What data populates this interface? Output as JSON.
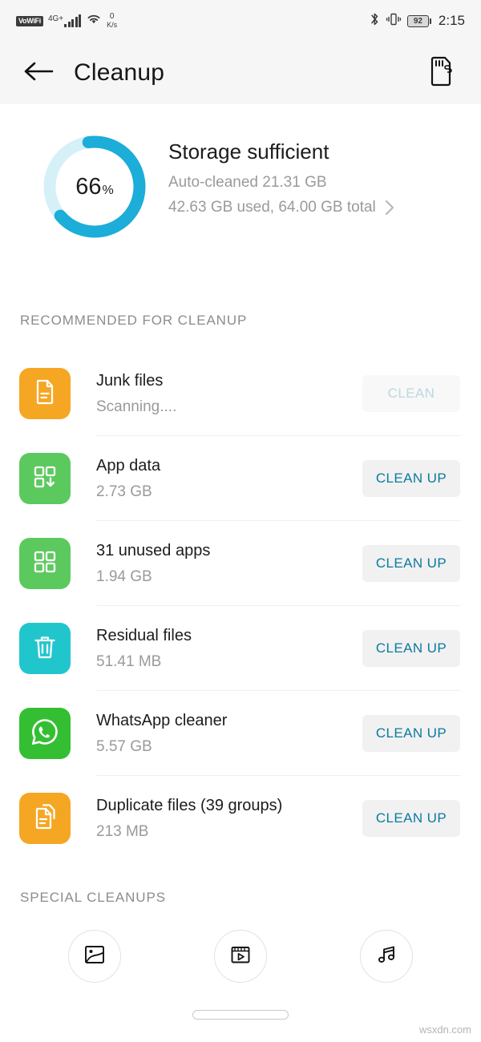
{
  "status_bar": {
    "vowifi_label": "VoWiFi",
    "network_gen": "4G",
    "network_gen_sup": "+",
    "data_rate_value": "0",
    "data_rate_unit": "K/s",
    "bluetooth_icon": "bluetooth-icon",
    "vibrate_icon": "vibrate-icon",
    "battery_level": "92",
    "time": "2:15"
  },
  "app_bar": {
    "back_icon": "back-arrow-icon",
    "title": "Cleanup",
    "sd_card_icon": "sd-card-icon"
  },
  "storage": {
    "percent_value": "66",
    "percent_symbol": "%",
    "percent_number": 66,
    "status_title": "Storage sufficient",
    "auto_cleaned": "Auto-cleaned 21.31 GB",
    "usage": "42.63 GB used, 64.00 GB total",
    "chevron_icon": "chevron-right-icon",
    "ring_track_color": "#d6f0f8",
    "ring_progress_color": "#1cadd8"
  },
  "sections": {
    "recommended_label": "RECOMMENDED FOR CLEANUP",
    "special_label": "SPECIAL CLEANUPS"
  },
  "cleanup_items": [
    {
      "name": "Junk files",
      "size": "Scanning....",
      "action": "CLEAN",
      "disabled": true,
      "icon": "document-icon",
      "tile_color": "#f5a623"
    },
    {
      "name": "App data",
      "size": "2.73 GB",
      "action": "CLEAN UP",
      "disabled": false,
      "icon": "app-data-download-icon",
      "tile_color": "#5cc95f"
    },
    {
      "name": "31 unused apps",
      "size": "1.94 GB",
      "action": "CLEAN UP",
      "disabled": false,
      "icon": "apps-grid-icon",
      "tile_color": "#5cc95f"
    },
    {
      "name": "Residual files",
      "size": "51.41 MB",
      "action": "CLEAN UP",
      "disabled": false,
      "icon": "trash-icon",
      "tile_color": "#21c6cd"
    },
    {
      "name": "WhatsApp cleaner",
      "size": "5.57 GB",
      "action": "CLEAN UP",
      "disabled": false,
      "icon": "whatsapp-icon",
      "tile_color": "#34bf32"
    },
    {
      "name": "Duplicate files (39 groups)",
      "size": "213 MB",
      "action": "CLEAN UP",
      "disabled": false,
      "icon": "duplicate-files-icon",
      "tile_color": "#f5a623"
    }
  ],
  "special_cleanups": [
    {
      "icon": "image-icon"
    },
    {
      "icon": "video-icon"
    },
    {
      "icon": "music-icon"
    }
  ],
  "nav_bar": {
    "gesture_pill": "home-gesture-pill"
  },
  "watermark": "wsxdn.com"
}
